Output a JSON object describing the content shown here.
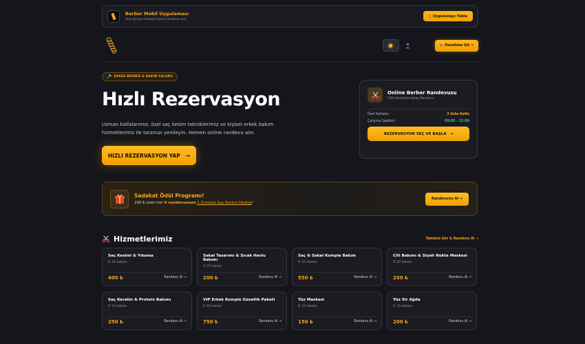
{
  "app_banner": {
    "title": "Berber Mobil Uygulaması",
    "subtitle": "Ana ekrana ekleyip hızlıca randevu alın",
    "button": "Uygulamayı Yükle"
  },
  "header": {
    "panel_button": "Panelime Git →"
  },
  "hero": {
    "badge": "ERKEK BERBER & BAKIM SALONU",
    "title": "Hızlı Rezervasyon",
    "description": "Uzman kalfalarımız, özel saç kesim tekniklerimiz ve kişisel erkek bakım hizmetlerimiz ile tarzınızı yenileyin. Hemen online randevu alın.",
    "cta": "HIZLI REZERVASYON YAP",
    "cta_arrow": "→"
  },
  "online_card": {
    "title": "Online Berber Randevusu",
    "subtitle": "7/24 Kesintisiz Kolay Randevu",
    "rows": [
      {
        "label": "Özel Kalfalar:",
        "value": "3 Usta Kalfa"
      },
      {
        "label": "Çalışma Saatleri:",
        "value": "09:00 - 22:00"
      }
    ],
    "button": "REZERVASYON SEÇ VE BAŞLA",
    "button_arrow": "→"
  },
  "loyalty": {
    "title": "Sadakat Ödül Programı!",
    "text_1": "200 ₺ üzeri her ",
    "highlight": "6 randevunuza",
    "text_2": " ",
    "link": "1 Ücretsiz Saç Kesimi Hediye",
    "text_3": "!",
    "button": "Randevunu Al →"
  },
  "services": {
    "title": "Hizmetlerimiz",
    "see_all": "Tümünü Gör & Randevu Al →",
    "book_label": "Randevu Al →",
    "items": [
      {
        "name": "Saç Kesimi & Yıkama",
        "duration": "35 dakika",
        "price": "400 ₺"
      },
      {
        "name": "Sakal Tasarımı & Sıcak Havlu Bakımı",
        "duration": "25 dakika",
        "price": "200 ₺"
      },
      {
        "name": "Saç & Sakal Komple Bakım",
        "duration": "55 dakika",
        "price": "550 ₺"
      },
      {
        "name": "Cilt Bakımı & Siyah Nokta Maskesi",
        "duration": "25 dakika",
        "price": "250 ₺"
      },
      {
        "name": "Saç Keratin & Protein Bakımı",
        "duration": "25 dakika",
        "price": "250 ₺"
      },
      {
        "name": "VIP Erkek Komple Güzellik Paketi",
        "duration": "60 dakika",
        "price": "750 ₺"
      },
      {
        "name": "Yüz Maskesi",
        "duration": "20 dakika",
        "price": "150 ₺"
      },
      {
        "name": "Yüz Sir Ağda",
        "duration": "15 dakika",
        "price": "200 ₺"
      }
    ]
  },
  "colors": {
    "background": "#15161c",
    "accent": "#f5a623",
    "card": "#1b1c22",
    "success": "#22c98a"
  },
  "icons": [
    "phone-icon",
    "barber-pole-logo",
    "sun-icon",
    "user-icon",
    "scissors-icon",
    "gift-icon",
    "clock-icon"
  ]
}
